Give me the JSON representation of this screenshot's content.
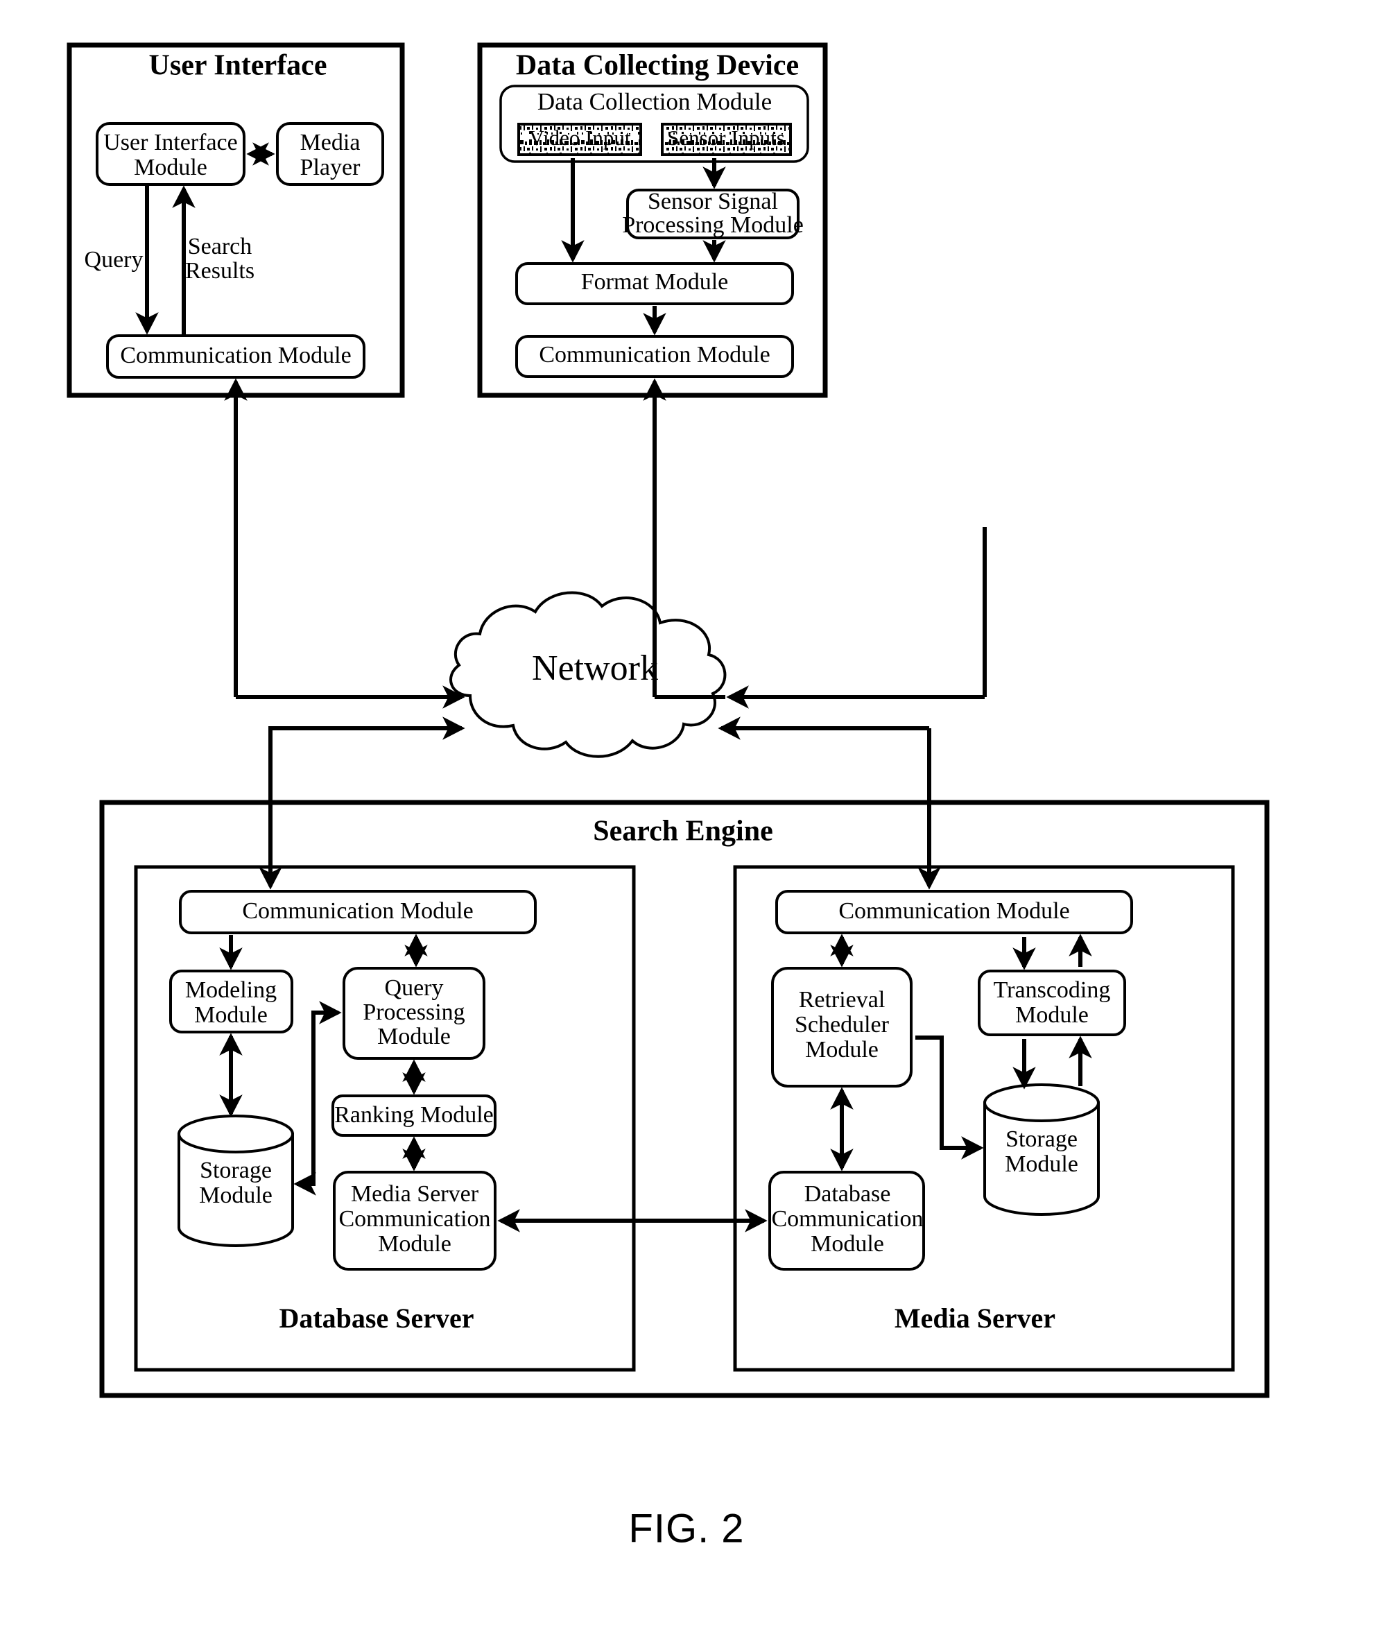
{
  "figure": {
    "caption": "FIG. 2"
  },
  "panels": {
    "user_interface": {
      "title": "User Interface",
      "boxes": {
        "ui_module": {
          "line1": "User Interface",
          "line2": "Module"
        },
        "media_player": {
          "line1": "Media",
          "line2": "Player"
        },
        "communication_module": {
          "label": "Communication Module"
        }
      },
      "edge_labels": {
        "query": "Query",
        "search_results_line1": "Search",
        "search_results_line2": "Results"
      }
    },
    "data_collecting_device": {
      "title": "Data Collecting Device",
      "group": {
        "label": "Data Collection Module"
      },
      "boxes": {
        "video_input": {
          "label": "Video Input"
        },
        "sensor_inputs": {
          "label": "Sensor Inputs"
        },
        "sensor_signal_processing": {
          "line1": "Sensor Signal",
          "line2": "Processing Module"
        },
        "format_module": {
          "label": "Format Module"
        },
        "communication_module": {
          "label": "Communication Module"
        }
      }
    },
    "network": {
      "label": "Network"
    },
    "search_engine": {
      "title": "Search Engine",
      "database_server": {
        "title": "Database Server",
        "boxes": {
          "communication_module": {
            "label": "Communication Module"
          },
          "modeling_module": {
            "line1": "Modeling",
            "line2": "Module"
          },
          "query_processing_module": {
            "line1": "Query",
            "line2": "Processing",
            "line3": "Module"
          },
          "storage_module": {
            "line1": "Storage",
            "line2": "Module"
          },
          "ranking_module": {
            "label": "Ranking Module"
          },
          "media_server_communication_module": {
            "line1": "Media Server",
            "line2": "Communication",
            "line3": "Module"
          }
        }
      },
      "media_server": {
        "title": "Media Server",
        "boxes": {
          "communication_module": {
            "label": "Communication Module"
          },
          "retrieval_scheduler_module": {
            "line1": "Retrieval",
            "line2": "Scheduler",
            "line3": "Module"
          },
          "transcoding_module": {
            "line1": "Transcoding",
            "line2": "Module"
          },
          "storage_module": {
            "line1": "Storage",
            "line2": "Module"
          },
          "database_communication_module": {
            "line1": "Database",
            "line2": "Communication",
            "line3": "Module"
          }
        }
      }
    }
  },
  "colors": {
    "stroke": "#000000",
    "background": "#ffffff"
  }
}
